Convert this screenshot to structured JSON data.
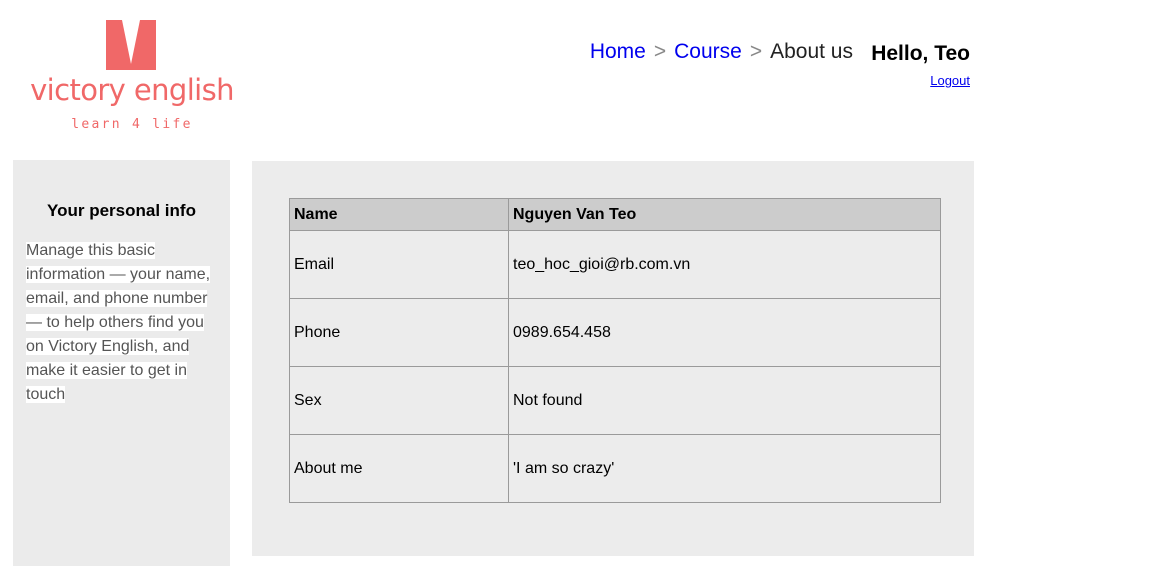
{
  "logo": {
    "brand": "victory english",
    "tagline": "learn 4 life",
    "color": "#f06868"
  },
  "nav": {
    "breadcrumb": [
      {
        "label": "Home",
        "link": true
      },
      {
        "label": "Course",
        "link": true
      },
      {
        "label": "About us",
        "link": false
      }
    ],
    "separator": ">"
  },
  "user": {
    "greeting": "Hello, Teo",
    "logout_label": "Logout"
  },
  "sidebar": {
    "title": "Your personal info",
    "description": "Manage this basic information — your name, email, and phone number — to help others find you on Victory English, and make it easier to get in touch"
  },
  "profile": {
    "header": {
      "key": "Name",
      "value": "Nguyen Van Teo"
    },
    "rows": [
      {
        "key": "Email",
        "value": "teo_hoc_gioi@rb.com.vn"
      },
      {
        "key": "Phone",
        "value": "0989.654.458"
      },
      {
        "key": "Sex",
        "value": "Not found"
      },
      {
        "key": "About me",
        "value": "'I am so crazy'"
      }
    ]
  }
}
